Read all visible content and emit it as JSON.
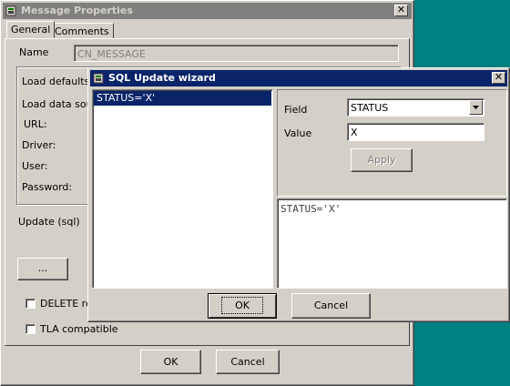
{
  "message_properties": {
    "title": "Message Properties",
    "tabs": [
      "General",
      "Comments"
    ],
    "name_label": "Name",
    "name_value": "CN_MESSAGE",
    "load_defaults_label": "Load defaults f",
    "load_data_label": "Load data sour",
    "url_label": "URL:",
    "driver_label": "Driver:",
    "user_label": "User:",
    "password_label": "Password:",
    "update_sql_label": "Update (sql)",
    "ellipsis_button": "...",
    "delete_checkbox_label": "DELETE rec",
    "tla_checkbox_label": "TLA compatible",
    "ok_button": "OK",
    "cancel_button": "Cancel"
  },
  "sql_wizard": {
    "title": "SQL Update wizard",
    "list_items": [
      "STATUS='X'"
    ],
    "field_label": "Field",
    "field_value": "STATUS",
    "value_label": "Value",
    "value_value": "X",
    "apply_button": "Apply",
    "sql_preview": "STATUS='X'",
    "ok_button": "OK",
    "cancel_button": "Cancel"
  },
  "colors": {
    "desktop": "#008080",
    "active_title": "#0a246a",
    "inactive_title": "#808080",
    "face": "#d4d0c8"
  }
}
